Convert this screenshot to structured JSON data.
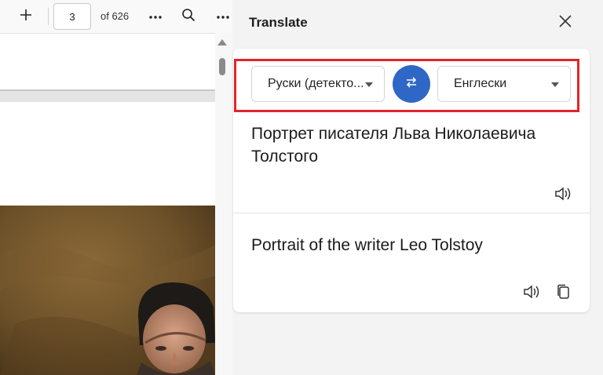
{
  "viewer": {
    "current_page": "3",
    "page_total_label": "of 626",
    "icons": {
      "add": "plus-icon",
      "more": "more-horizontal-icon",
      "search": "search-icon"
    }
  },
  "panel": {
    "title": "Translate",
    "source_language": "Руски (детекто...",
    "target_language": "Енглески",
    "source_text": "Портрет писателя Льва Николаевича Толстого",
    "translated_text": "Portrait of the writer Leo Tolstoy",
    "accent_color": "#2f67c6",
    "highlight_color": "#e3242b"
  }
}
